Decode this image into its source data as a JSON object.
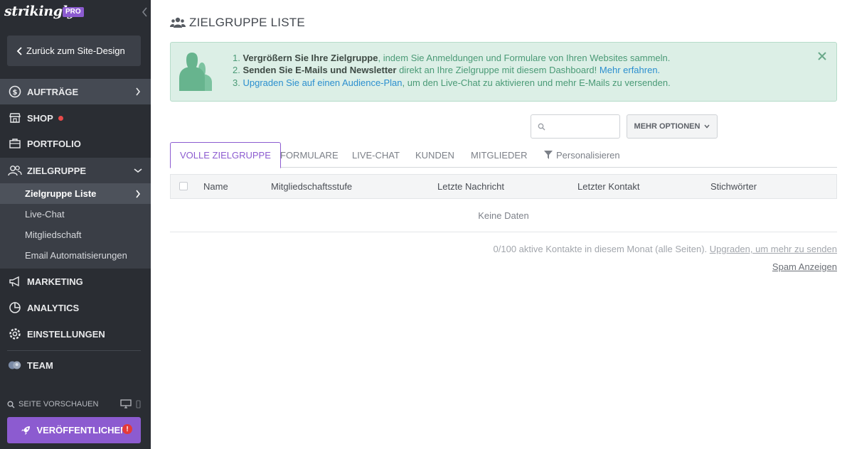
{
  "sidebar": {
    "logo": "strikingly",
    "badge": "PRO",
    "back_label": "Zurück zum Site-Design",
    "items": [
      {
        "label": "AUFTRÄGE",
        "icon": "dollar-circle-icon"
      },
      {
        "label": "SHOP",
        "icon": "store-icon"
      },
      {
        "label": "PORTFOLIO",
        "icon": "briefcase-icon"
      },
      {
        "label": "ZIELGRUPPE",
        "icon": "users-icon"
      },
      {
        "label": "MARKETING",
        "icon": "megaphone-icon"
      },
      {
        "label": "ANALYTICS",
        "icon": "pie-chart-icon"
      },
      {
        "label": "EINSTELLUNGEN",
        "icon": "gear-icon"
      },
      {
        "label": "TEAM",
        "icon": "team-avatar-icon"
      }
    ],
    "subitems": [
      "Zielgruppe Liste",
      "Live-Chat",
      "Mitgliedschaft",
      "Email Automatisierungen"
    ],
    "preview_label": "SEITE VORSCHAUEN",
    "publish_label": "VERÖFFENTLICHEN",
    "publish_alert": "!",
    "colors": {
      "background": "#2a2d33",
      "accent": "#8c5bd0",
      "notification": "#e84a4a"
    }
  },
  "main": {
    "title": "ZIELGRUPPE LISTE",
    "banner": {
      "line1_num": "1.",
      "line1_bold": "Vergrößern Sie Ihre Zielgruppe",
      "line1_text": ", indem Sie Anmeldungen und Formulare von Ihren Websites sammeln.",
      "line2_num": "2.",
      "line2_bold": "Senden Sie E-Mails und Newsletter",
      "line2_text": " direkt an Ihre Zielgruppe mit diesem Dashboard!",
      "line2_link": "Mehr erfahren.",
      "line3_num": "3.",
      "line3_link": "Upgraden Sie auf einen Audience-Plan",
      "line3_text": ", um den Live-Chat zu aktivieren und mehr E-Mails zu versenden.",
      "colors": {
        "background": "#dcefe6",
        "text": "#4a9a76",
        "link": "#2b8fcf"
      }
    },
    "search": {
      "placeholder": "",
      "value": ""
    },
    "more_options_label": "MEHR OPTIONEN",
    "tabs": [
      "VOLLE ZIELGRUPPE",
      "FORMULARE",
      "LIVE-CHAT",
      "KUNDEN",
      "MITGLIEDER",
      "Personalisieren"
    ],
    "table": {
      "columns": [
        "Name",
        "Mitgliedschaftsstufe",
        "Letzte Nachricht",
        "Letzter Kontakt",
        "Stichwörter"
      ],
      "empty": "Keine Daten"
    },
    "footer": {
      "contacts_text": "0/100 aktive Kontakte in diesem Monat (alle Seiten).",
      "upgrade_link": "Upgraden, um mehr zu senden",
      "spam_link": "Spam Anzeigen"
    }
  }
}
